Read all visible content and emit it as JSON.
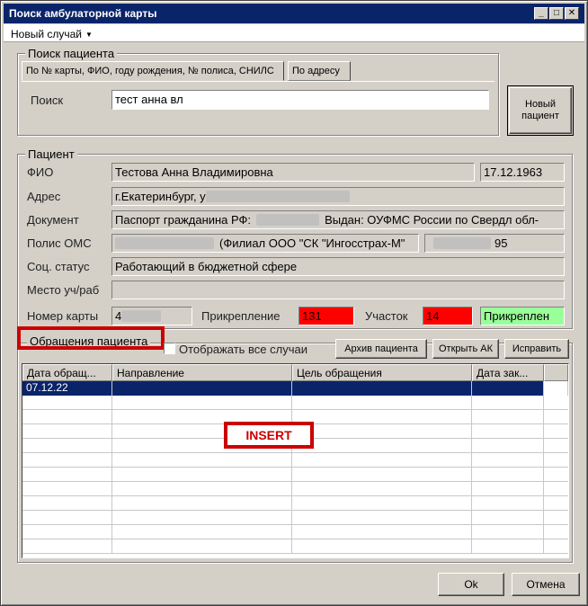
{
  "window": {
    "title": "Поиск амбулаторной карты",
    "controls": [
      "_",
      "□",
      "✕"
    ]
  },
  "menu": {
    "new_case": "Новый случай"
  },
  "search": {
    "group_label": "Поиск пациента",
    "tabs": [
      "По № карты, ФИО, году рождения, № полиса, СНИЛС",
      "По адресу"
    ],
    "label": "Поиск",
    "value": "тест анна вл",
    "new_patient_button": "Новый пациент"
  },
  "patient": {
    "group_label": "Пациент",
    "fio_label": "ФИО",
    "fio": "Тестова Анна Владимировна",
    "birth_date": "17.12.1963",
    "address_label": "Адрес",
    "address": "г.Екатеринбург, у",
    "document_label": "Документ",
    "document": "Паспорт гражданина РФ:",
    "document_issued": "Выдан: ОУФМС России по Свердл обл-",
    "oms_label": "Полис ОМС",
    "oms_insurer": "(Филиал ООО \"СК \"Ингосстрах-М\"",
    "oms_suffix": "95",
    "social_label": "Соц. статус",
    "social": "Работающий в бюджетной сфере",
    "workplace_label": "Место уч/раб",
    "workplace": "",
    "card_label": "Номер карты",
    "card_number": "4",
    "attachment_label": "Прикрепление",
    "attachment_value": "131",
    "district_label": "Участок",
    "district_value": "14",
    "status_value": "Прикреплен"
  },
  "visits": {
    "group_label": "Обращения пациента",
    "show_all_label": "Отображать все случаи",
    "buttons": {
      "archive": "Архив пациента",
      "open_ak": "Открыть АК",
      "fix": "Исправить"
    },
    "columns": [
      "Дата обращ...",
      "Направление",
      "Цель обращения",
      "Дата зак..."
    ],
    "rows": [
      [
        "07.12.22",
        "",
        "",
        ""
      ]
    ],
    "annotation": "INSERT"
  },
  "footer": {
    "ok": "Ok",
    "cancel": "Отмена"
  },
  "colors": {
    "titlebar": "#0a246a",
    "selection": "#0a246a",
    "alert_red": "#ff0000",
    "status_green": "#99ff99",
    "annotation_red": "#cc0000"
  }
}
